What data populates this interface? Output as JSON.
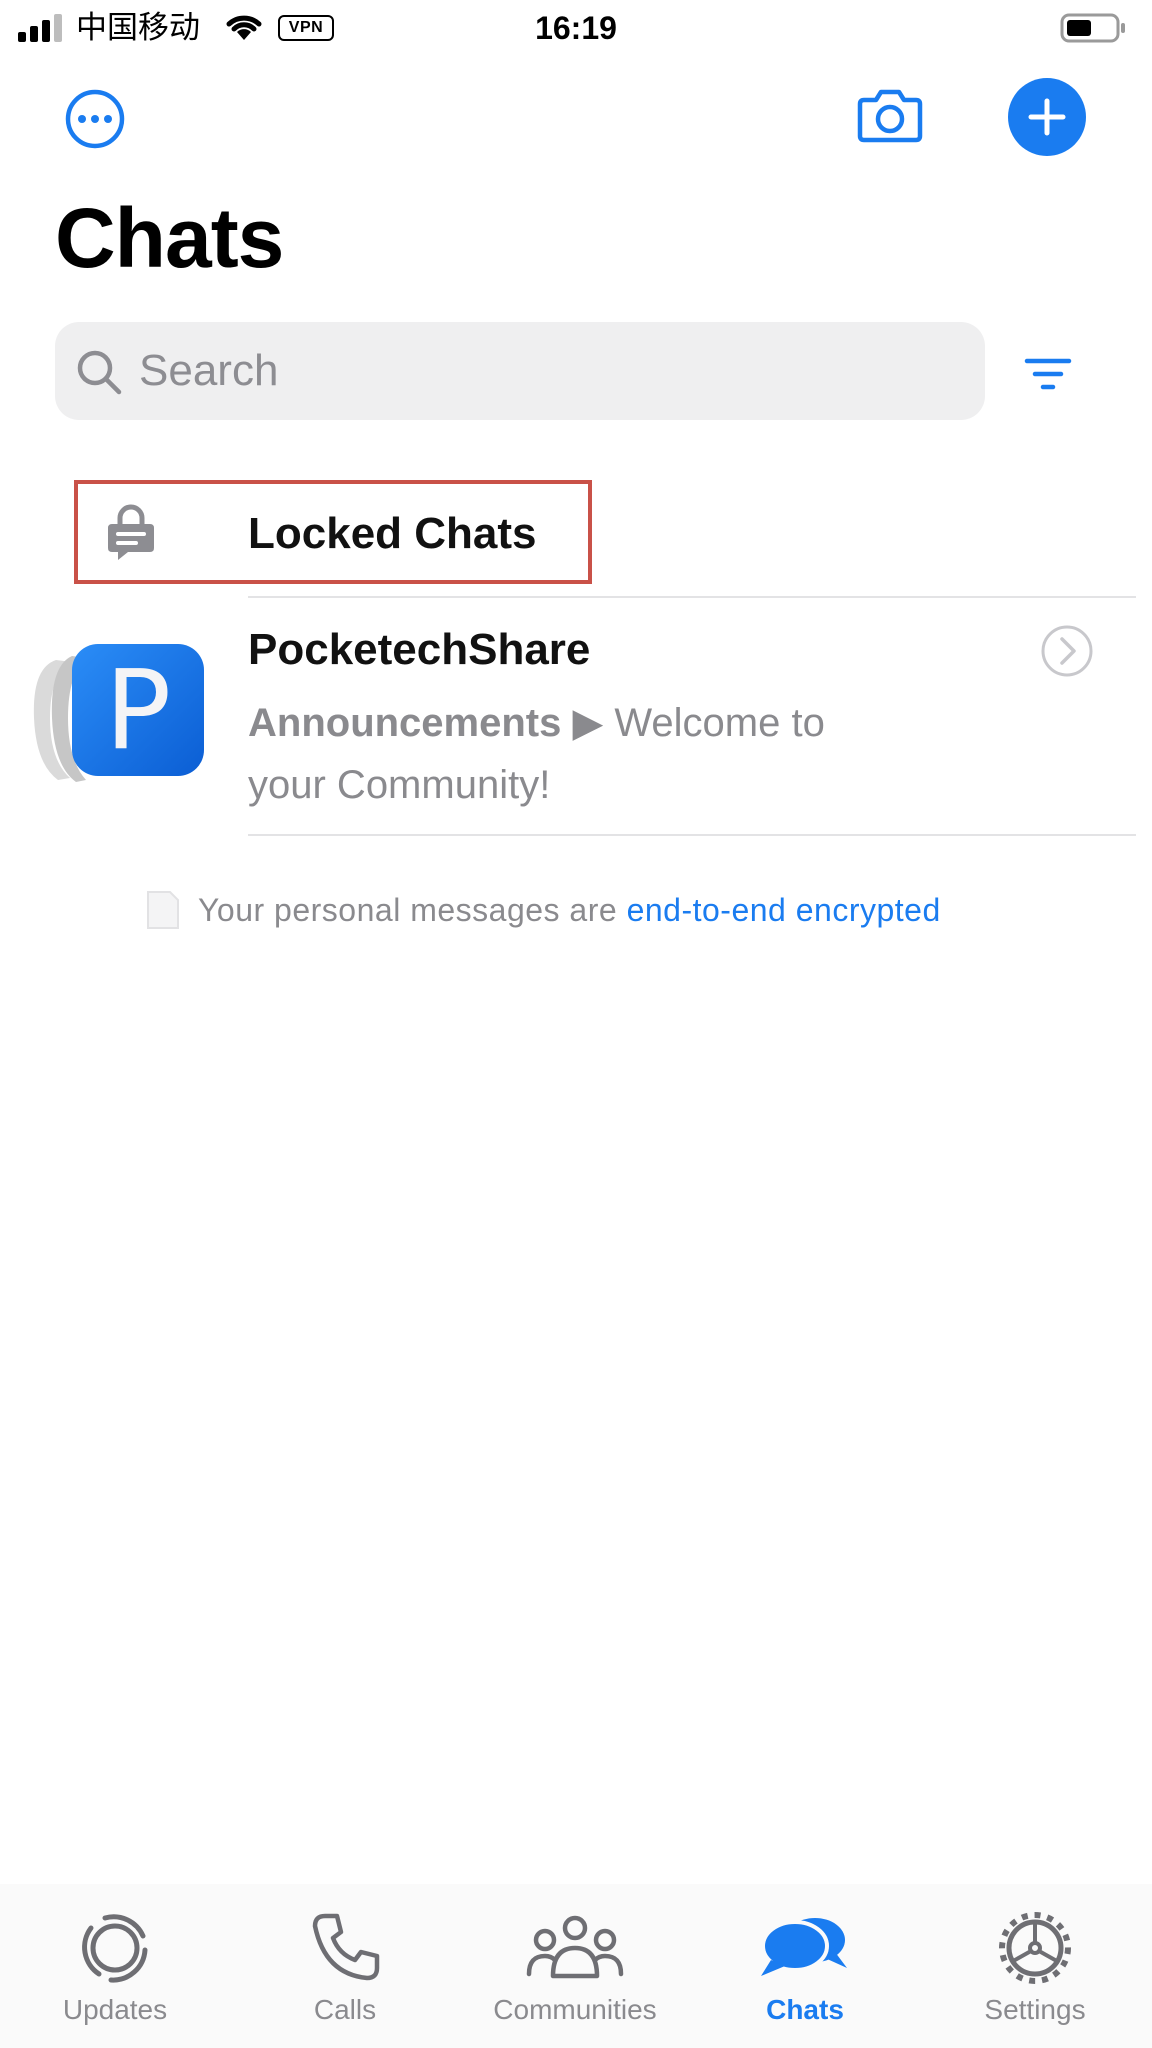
{
  "status_bar": {
    "carrier": "中国移动",
    "vpn": "VPN",
    "time": "16:19"
  },
  "toolbar": {
    "more_icon": "ellipsis-circle-icon",
    "camera_icon": "camera-icon",
    "new_chat_icon": "plus-icon",
    "accent": "#1a7cf0"
  },
  "page": {
    "title": "Chats"
  },
  "search": {
    "placeholder": "Search",
    "value": ""
  },
  "locked_chats": {
    "label": "Locked Chats",
    "icon": "lock-chat-icon",
    "highlight_color": "#c95148"
  },
  "chats": [
    {
      "name": "PocketechShare",
      "avatar_letter": "P",
      "group": "Announcements",
      "separator": "▶",
      "preview": "Welcome to your Community!"
    }
  ],
  "encryption": {
    "text": "Your personal messages are ",
    "link": "end-to-end encrypted"
  },
  "tabs": [
    {
      "label": "Updates",
      "icon": "updates-icon",
      "active": false
    },
    {
      "label": "Calls",
      "icon": "phone-icon",
      "active": false
    },
    {
      "label": "Communities",
      "icon": "communities-icon",
      "active": false
    },
    {
      "label": "Chats",
      "icon": "chats-icon",
      "active": true
    },
    {
      "label": "Settings",
      "icon": "gear-icon",
      "active": false
    }
  ]
}
